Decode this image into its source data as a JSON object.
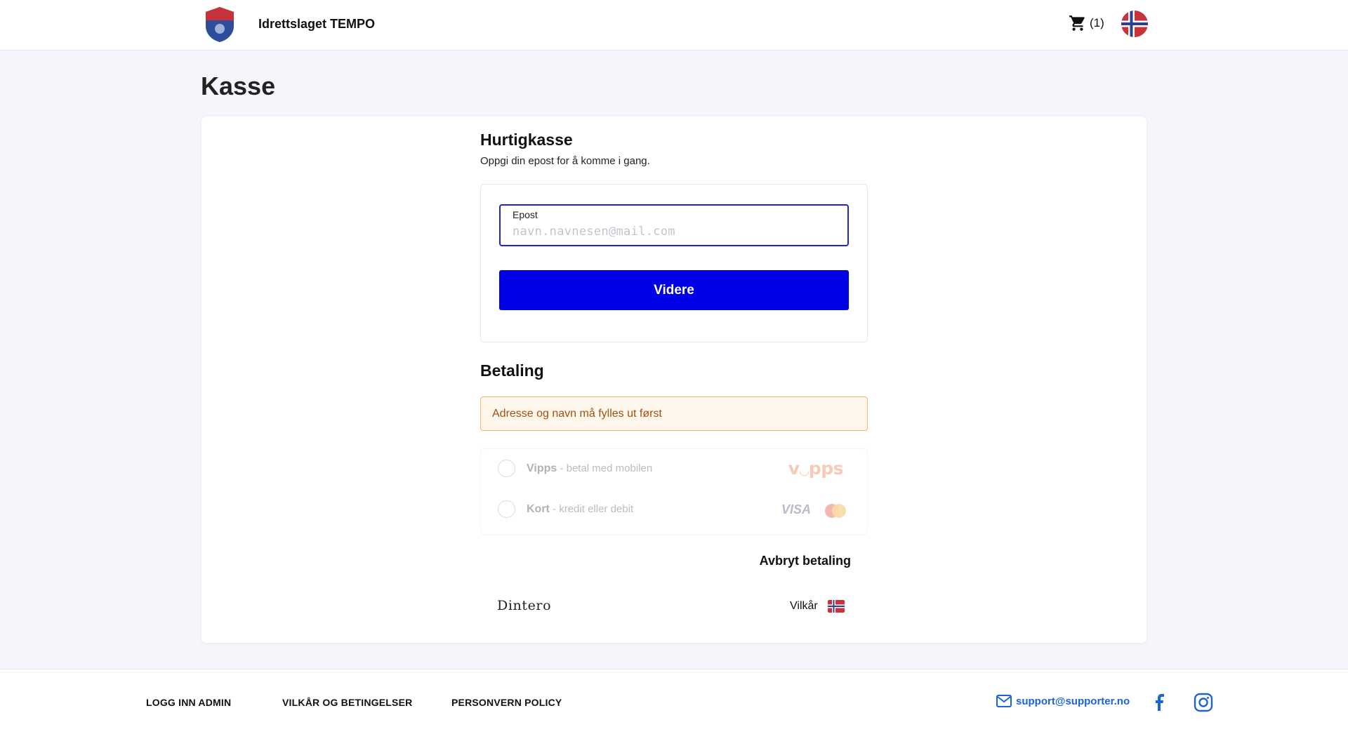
{
  "header": {
    "club_name": "Idrettslaget TEMPO",
    "cart_count": "(1)"
  },
  "page": {
    "title": "Kasse"
  },
  "express_checkout": {
    "title": "Hurtigkasse",
    "subtitle": "Oppgi din epost for å komme i gang.",
    "email_label": "Epost",
    "email_value": "",
    "email_placeholder": "navn.navnesen@mail.com",
    "continue_label": "Videre"
  },
  "payment": {
    "title": "Betaling",
    "warning": "Adresse og navn må fylles ut først",
    "methods": [
      {
        "name": "Vipps",
        "description": " - betal med mobilen",
        "logo": "vipps"
      },
      {
        "name": "Kort",
        "description": " - kredit eller debit",
        "logo_text": "VISA"
      }
    ],
    "cancel_label": "Avbryt betaling"
  },
  "powered_by": {
    "brand": "Dintero",
    "terms_label": "Vilkår"
  },
  "footer": {
    "links": [
      "LOGG INN ADMIN",
      "VILKÅR OG BETINGELSER",
      "PERSONVERN POLICY"
    ],
    "support_email": "support@supporter.no"
  },
  "colors": {
    "primary": "#0000e6",
    "warning_border": "#f0b86a",
    "warning_bg": "#fff6ec",
    "link": "#1a64d6"
  }
}
